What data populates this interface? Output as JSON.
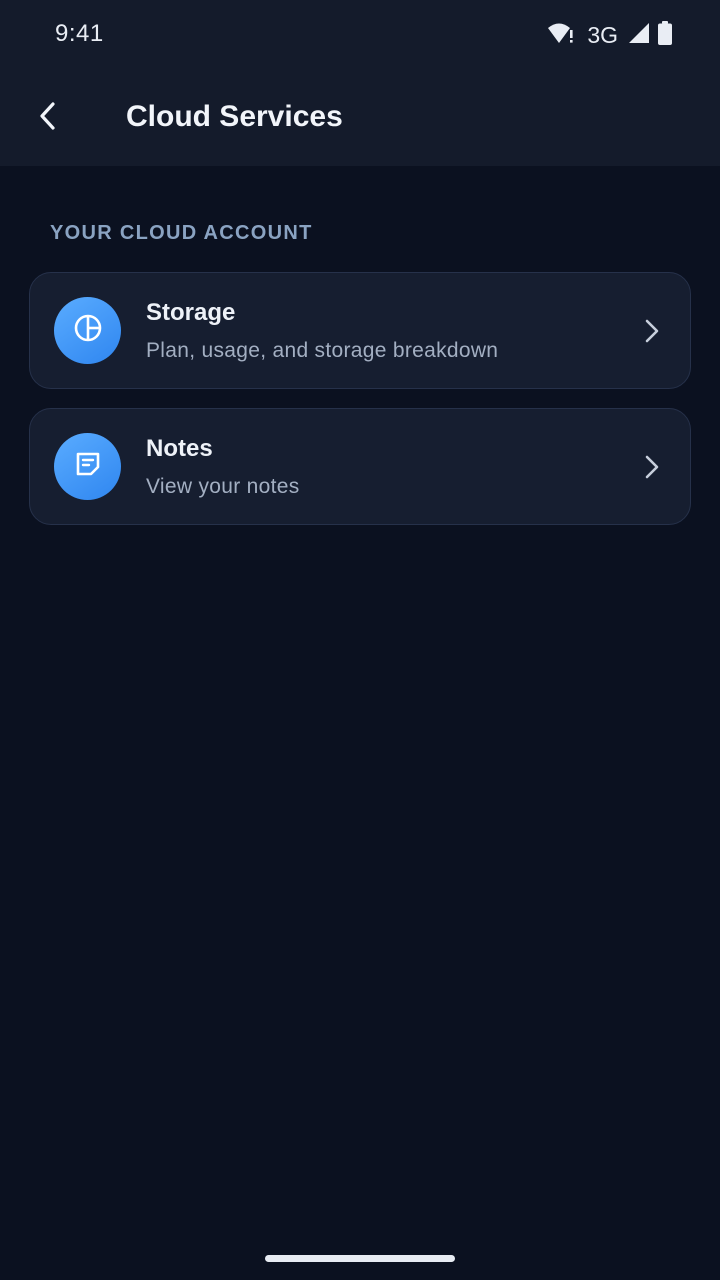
{
  "status_bar": {
    "time": "9:41",
    "network": "3G",
    "icons": [
      "wifi-alert-icon",
      "cell-signal-icon",
      "battery-icon"
    ]
  },
  "app_bar": {
    "title": "Cloud Services",
    "back_icon": "chevron-left-icon"
  },
  "section": {
    "header": "YOUR CLOUD ACCOUNT",
    "items": [
      {
        "title": "Storage",
        "subtitle": "Plan, usage, and storage breakdown",
        "icon": "pie-chart-icon"
      },
      {
        "title": "Notes",
        "subtitle": "View your notes",
        "icon": "note-icon"
      }
    ]
  },
  "colors": {
    "background": "#0b1120",
    "bar": "#141b2b",
    "card": "#161e30",
    "card_border": "#26314a",
    "accent": "#3d93f7",
    "section_header": "#8aa3c2"
  }
}
